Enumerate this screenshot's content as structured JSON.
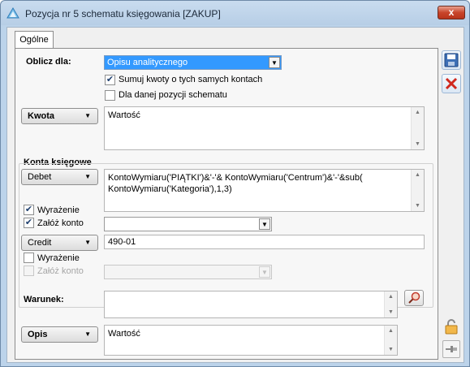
{
  "window": {
    "title": "Pozycja nr 5 schematu księgowania [ZAKUP]",
    "close_glyph": "x"
  },
  "tabs": [
    {
      "label": "Ogólne"
    }
  ],
  "oblicz": {
    "label": "Oblicz dla:",
    "select_value": "Opisu analitycznego",
    "checkbox_sumuj": {
      "label": "Sumuj kwoty o tych samych kontach",
      "checked": true
    },
    "checkbox_pozycja": {
      "label": "Dla danej pozycji schematu",
      "checked": false
    }
  },
  "kwota": {
    "button_label": "Kwota",
    "value": "Wartość"
  },
  "konta": {
    "group_title": "Konta księgowe",
    "debet": {
      "button_label": "Debet",
      "expression": "KontoWymiaru('PIĄTKI')&'-'& KontoWymiaru('Centrum')&'-'&sub(\nKontoWymiaru('Kategoria'),1,3)",
      "wyrazenie": {
        "label": "Wyrażenie",
        "checked": true
      },
      "zaloz_konto": {
        "label": "Załóż konto",
        "checked": true
      },
      "konto_select": ""
    },
    "credit": {
      "button_label": "Credit",
      "value": "490-01",
      "wyrazenie": {
        "label": "Wyrażenie",
        "checked": false
      },
      "zaloz_konto": {
        "label": "Załóż konto",
        "checked": false,
        "disabled": true
      },
      "konto_select": ""
    }
  },
  "warunek": {
    "label": "Warunek:",
    "value": ""
  },
  "opis": {
    "button_label": "Opis",
    "value": "Wartość"
  },
  "side_buttons": [
    {
      "name": "save",
      "icon": "floppy-disk-icon"
    },
    {
      "name": "cancel",
      "icon": "red-x-icon"
    }
  ],
  "bottom_buttons": [
    {
      "name": "lock",
      "icon": "padlock-icon"
    },
    {
      "name": "pin",
      "icon": "pin-icon"
    }
  ],
  "colors": {
    "accent": "#3399ff",
    "frame": "#bcd3ea"
  }
}
